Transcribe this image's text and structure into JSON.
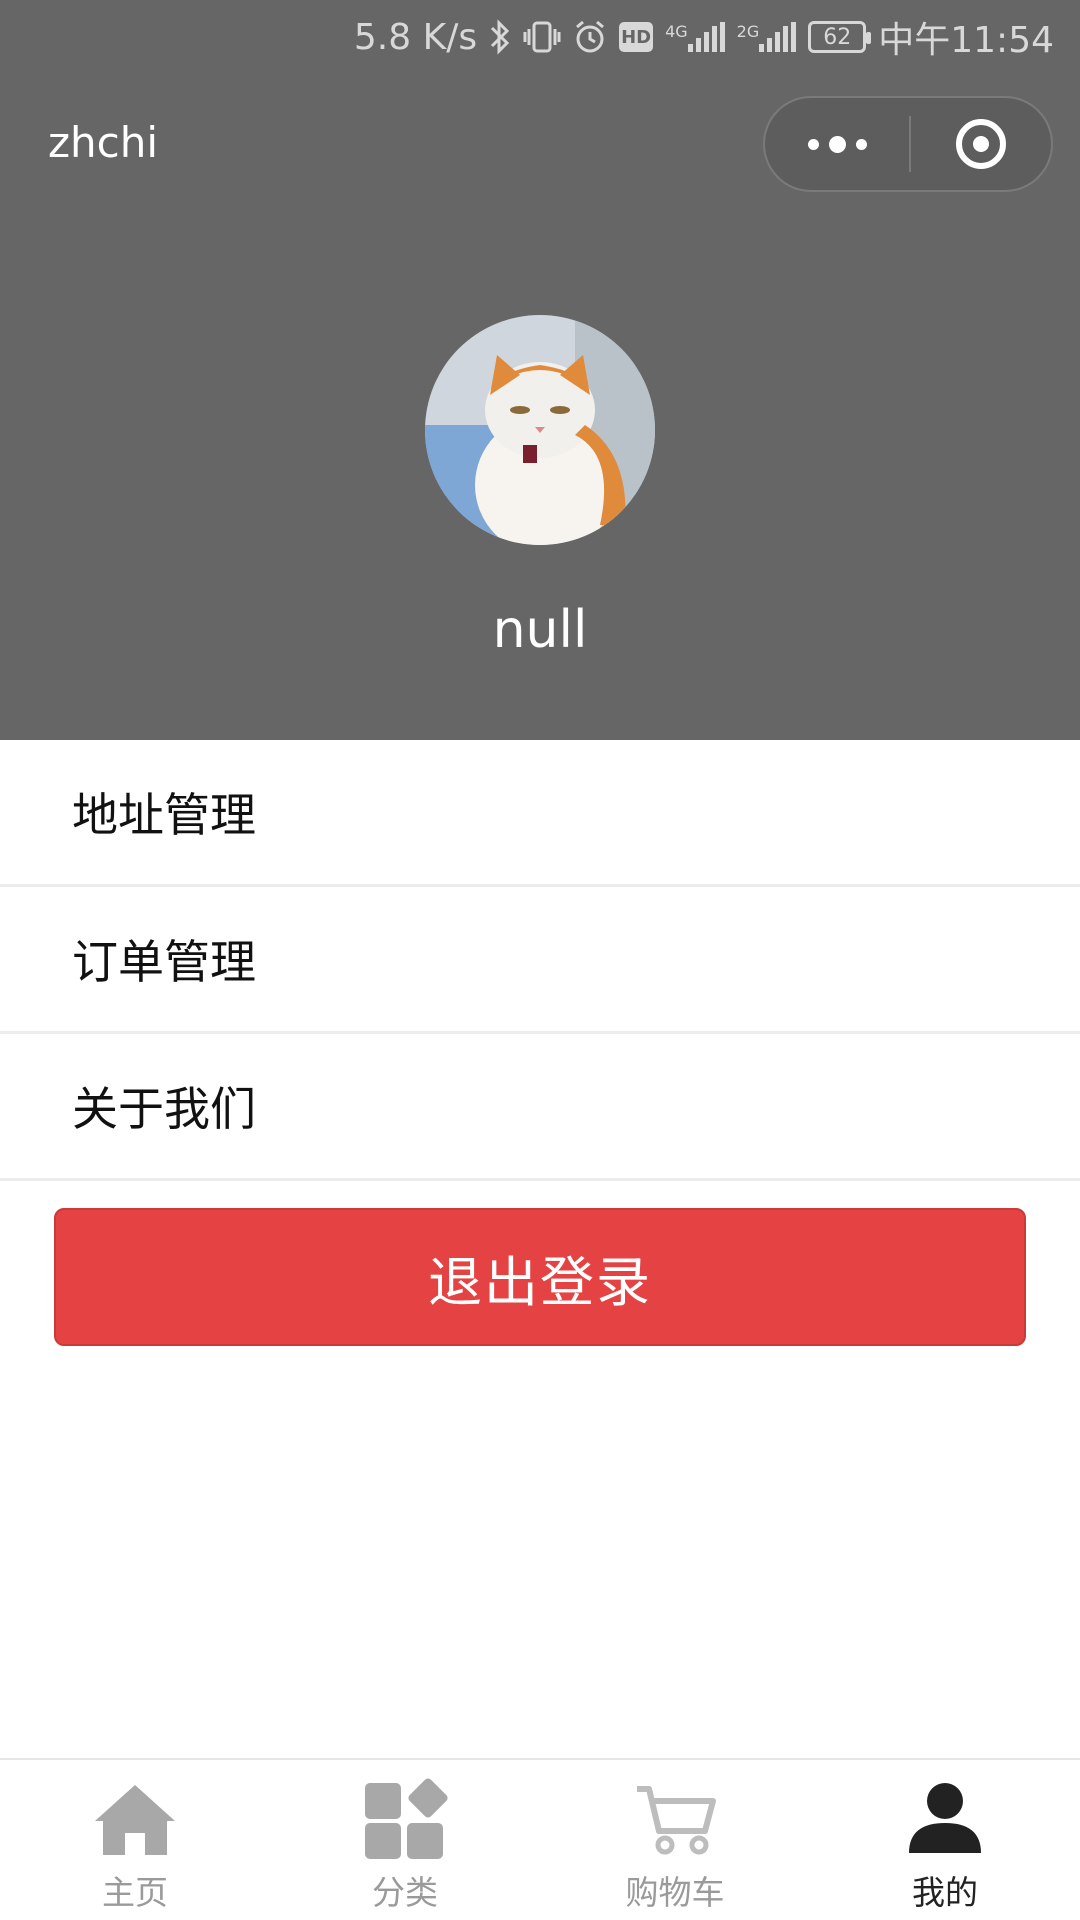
{
  "status_bar": {
    "speed": "5.8 K/s",
    "net_4g": "4G",
    "net_2g": "2G",
    "hd": "HD",
    "battery": "62",
    "time": "中午11:54"
  },
  "nav": {
    "title": "zhchi"
  },
  "profile": {
    "username": "null"
  },
  "menu": {
    "items": [
      {
        "label": "地址管理"
      },
      {
        "label": "订单管理"
      },
      {
        "label": "关于我们"
      }
    ]
  },
  "logout_label": "退出登录",
  "tabbar": {
    "tabs": [
      {
        "label": "主页",
        "icon": "home-icon"
      },
      {
        "label": "分类",
        "icon": "category-icon"
      },
      {
        "label": "购物车",
        "icon": "cart-icon"
      },
      {
        "label": "我的",
        "icon": "user-icon"
      }
    ],
    "active_index": 3
  },
  "colors": {
    "header_bg": "#666666",
    "logout_bg": "#e54343",
    "tab_inactive": "#9a9a9a",
    "tab_active": "#222222"
  }
}
